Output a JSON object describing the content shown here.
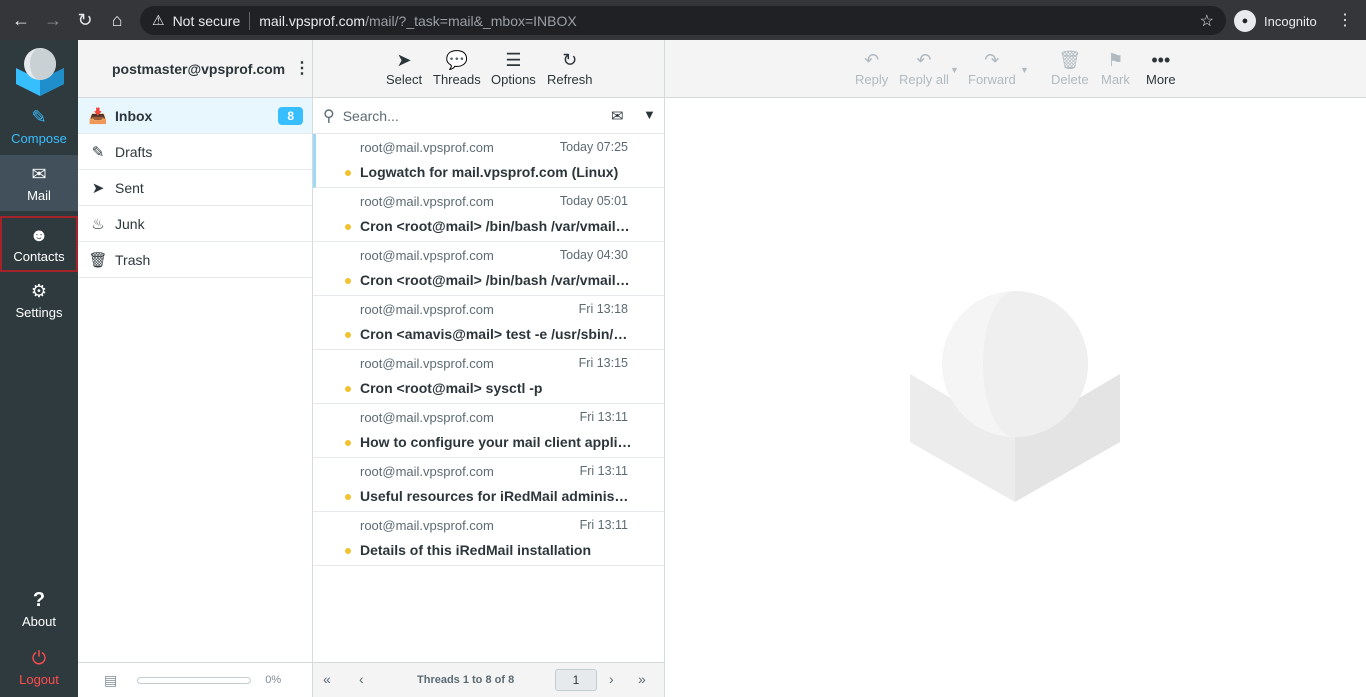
{
  "browser": {
    "not_secure": "Not secure",
    "host": "mail.vpsprof.com",
    "path": "/mail/?_task=mail&_mbox=INBOX",
    "incognito": "Incognito"
  },
  "nav": {
    "compose": "Compose",
    "mail": "Mail",
    "contacts": "Contacts",
    "settings": "Settings",
    "about": "About",
    "logout": "Logout"
  },
  "account": "postmaster@vpsprof.com",
  "folders": [
    {
      "label": "Inbox",
      "badge": "8"
    },
    {
      "label": "Drafts"
    },
    {
      "label": "Sent"
    },
    {
      "label": "Junk"
    },
    {
      "label": "Trash"
    }
  ],
  "quota": "0%",
  "list_toolbar": {
    "select": "Select",
    "threads": "Threads",
    "options": "Options",
    "refresh": "Refresh"
  },
  "search_placeholder": "Search...",
  "messages": [
    {
      "from": "root@mail.vpsprof.com",
      "date": "Today 07:25",
      "subject": "Logwatch for mail.vpsprof.com (Linux)"
    },
    {
      "from": "root@mail.vpsprof.com",
      "date": "Today 05:01",
      "subject": "Cron <root@mail> /bin/bash /var/vmail/b..."
    },
    {
      "from": "root@mail.vpsprof.com",
      "date": "Today 04:30",
      "subject": "Cron <root@mail> /bin/bash /var/vmail/b..."
    },
    {
      "from": "root@mail.vpsprof.com",
      "date": "Fri 13:18",
      "subject": "Cron <amavis@mail> test -e /usr/sbin/a..."
    },
    {
      "from": "root@mail.vpsprof.com",
      "date": "Fri 13:15",
      "subject": "Cron <root@mail> sysctl -p"
    },
    {
      "from": "root@mail.vpsprof.com",
      "date": "Fri 13:11",
      "subject": "How to configure your mail client applica..."
    },
    {
      "from": "root@mail.vpsprof.com",
      "date": "Fri 13:11",
      "subject": "Useful resources for iRedMail administra..."
    },
    {
      "from": "root@mail.vpsprof.com",
      "date": "Fri 13:11",
      "subject": "Details of this iRedMail installation"
    }
  ],
  "list_footer": {
    "count": "Threads 1 to 8 of 8",
    "page": "1"
  },
  "preview_toolbar": {
    "reply": "Reply",
    "reply_all": "Reply all",
    "forward": "Forward",
    "delete": "Delete",
    "mark": "Mark",
    "more": "More"
  },
  "colors": {
    "accent": "#37beff",
    "nav_bg": "#2f3a3f",
    "unread_dot": "#f0c330",
    "logout": "#ff4d4d"
  }
}
